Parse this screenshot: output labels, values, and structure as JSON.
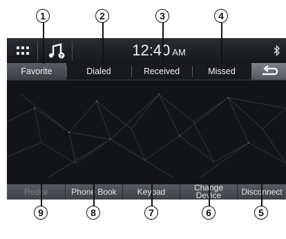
{
  "status_bar": {
    "time": "12:40",
    "ampm": "AM",
    "menu_icon": "grid-menu-icon",
    "audio_icon": "music-note-icon",
    "bluetooth_icon": "bluetooth-icon"
  },
  "tabs": [
    {
      "label": "Favorite",
      "active": true
    },
    {
      "label": "Dialed"
    },
    {
      "label": "Received"
    },
    {
      "label": "Missed"
    }
  ],
  "back_button": {
    "icon": "back-arrow-icon"
  },
  "bottom_buttons": [
    {
      "label": "Redial",
      "enabled": false
    },
    {
      "label": "Phone Book"
    },
    {
      "label": "Keypad"
    },
    {
      "label": "Change\nDevice"
    },
    {
      "label": "Disconnect"
    }
  ],
  "callouts": [
    "1",
    "2",
    "3",
    "4",
    "5",
    "6",
    "7",
    "8",
    "9"
  ],
  "colors": {
    "screen_bg": "#121417",
    "text": "#f0f0f0",
    "disabled_text": "#7d8086",
    "button_bg": "#4a4d52"
  }
}
